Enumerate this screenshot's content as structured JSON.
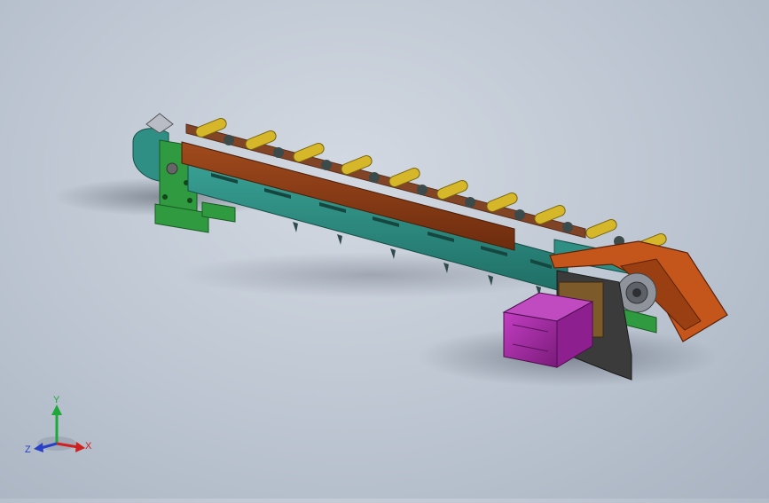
{
  "viewport": {
    "model": "chain-conveyor-assembly",
    "background_top": "#d3d9e2",
    "background_bottom": "#a9b3c1"
  },
  "colors": {
    "side_plate": "#2f8f84",
    "top_rail": "#8a3c16",
    "rollers": "#d6b72a",
    "brackets": "#2f9a3f",
    "motor": "#a62aa6",
    "mount_plate": "#3b3b3b",
    "end_guard": "#c4561c"
  },
  "triad": {
    "y_label": "Y",
    "x_label": "X",
    "z_label": "Z",
    "y_color": "#1fa83a",
    "x_color": "#d11f1f",
    "z_color": "#2a3fc7"
  }
}
